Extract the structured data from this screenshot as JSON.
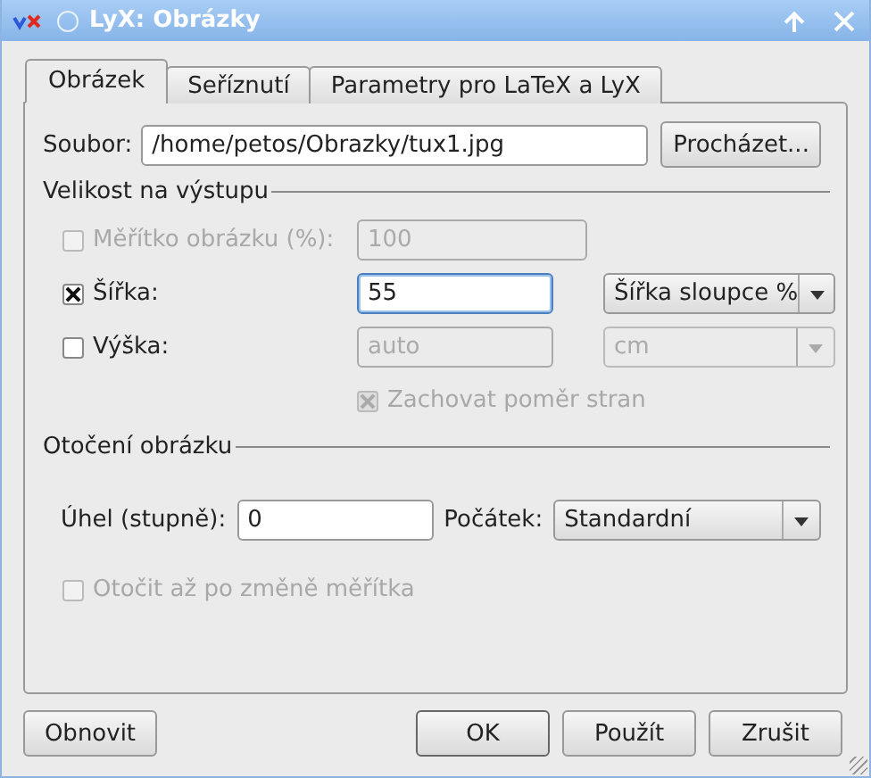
{
  "window": {
    "title": "LyX: Obrázky"
  },
  "tabs": [
    {
      "label": "Obrázek",
      "selected": true
    },
    {
      "label": "Seříznutí",
      "selected": false
    },
    {
      "label": "Parametry pro LaTeX a LyX",
      "selected": false
    }
  ],
  "file": {
    "label": "Soubor:",
    "value": "/home/petos/Obrazky/tux1.jpg",
    "browse_button": "Procházet..."
  },
  "size_group": {
    "title": "Velikost na výstupu",
    "rows": [
      {
        "label": "Měřítko obrázku (%):",
        "checked": false,
        "disabled": true,
        "value": "100",
        "field_disabled": true,
        "focused": false
      },
      {
        "label": "Šířka:",
        "checked": true,
        "disabled": false,
        "value": "55",
        "field_disabled": false,
        "focused": true,
        "unit": {
          "value": "Šířka sloupce %",
          "disabled": false
        }
      },
      {
        "label": "Výška:",
        "checked": false,
        "disabled": false,
        "value": "auto",
        "field_disabled": true,
        "focused": false,
        "unit": {
          "value": "cm",
          "disabled": true
        }
      }
    ],
    "keep_ratio": {
      "label": "Zachovat poměr stran",
      "checked": true,
      "disabled": true
    }
  },
  "rotation_group": {
    "title": "Otočení obrázku",
    "angle_label": "Úhel (stupně):",
    "angle_value": "0",
    "origin_label": "Počátek:",
    "origin_value": "Standardní",
    "rotate_after": {
      "label": "Otočit až po změně měřítka",
      "checked": false,
      "disabled": true
    }
  },
  "buttons": [
    {
      "label": "Obnovit",
      "default": false
    },
    {
      "label": "OK",
      "default": true
    },
    {
      "label": "Použít",
      "default": false
    },
    {
      "label": "Zrušit",
      "default": false
    }
  ]
}
